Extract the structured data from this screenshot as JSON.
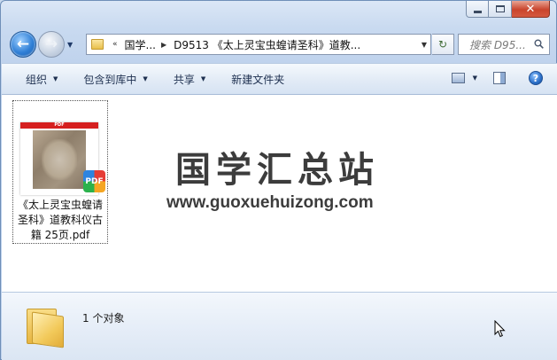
{
  "window": {
    "caption": {
      "minimize": "",
      "maximize": "",
      "close": "✕"
    }
  },
  "nav": {
    "back_glyph": "←",
    "forward_glyph": "→",
    "recent_glyph": "▼"
  },
  "address": {
    "overflow_glyph": "«",
    "crumbs": [
      "国学...",
      "D9513 《太上灵宝虫蝗请圣科》道教..."
    ],
    "separator_glyph": "▶",
    "dropdown_glyph": "▼",
    "refresh_glyph": "↻"
  },
  "search": {
    "placeholder": "搜索 D95..."
  },
  "commandbar": {
    "organize": "组织",
    "include_in_library": "包含到库中",
    "share": "共享",
    "new_folder": "新建文件夹",
    "dropdown_glyph": "▼",
    "help_glyph": "?"
  },
  "files": [
    {
      "thumb_band": "PDF",
      "badge": "PDF",
      "name_lines": [
        "《太上灵宝虫蝗请",
        "圣科》道教科仪古",
        "籍 25页.pdf"
      ]
    }
  ],
  "watermark": {
    "text": "国学汇总站",
    "url": "www.guoxuehuizong.com"
  },
  "details": {
    "item_count": "1 个对象"
  },
  "colors": {
    "accent": "#2f7fd6",
    "close": "#c9452d",
    "content_bg": "#ffffff",
    "chrome_bg": "#c9daf0"
  }
}
